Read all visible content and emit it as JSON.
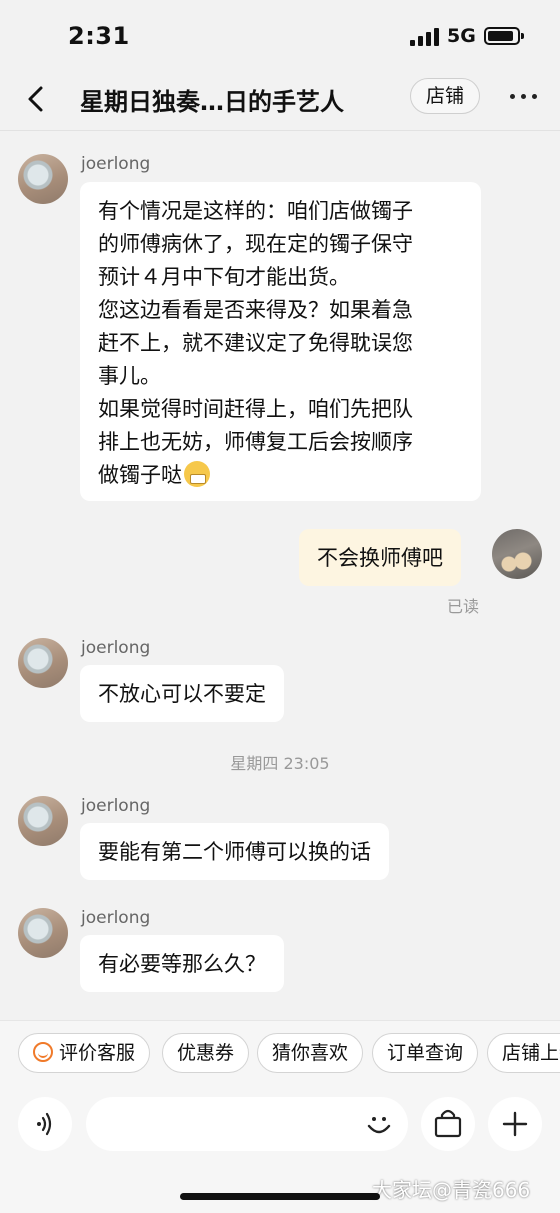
{
  "status_bar": {
    "time": "2:31",
    "network": "5G"
  },
  "nav": {
    "title": "星期日独奏…日的手艺人",
    "shop_button": "店铺"
  },
  "messages": [
    {
      "sender": "joerlong",
      "lines": [
        "有个情况是这样的：咱们店做镯子",
        "的师傅病休了，现在定的镯子保守",
        "预计４月中下旬才能出货。",
        "您这边看看是否来得及？如果着急",
        "赶不上，就不建议定了免得耽误您",
        "事儿。",
        "如果觉得时间赶得上，咱们先把队",
        "排上也无妨，师傅复工后会按顺序",
        "做镯子哒"
      ]
    },
    {
      "text": "不会换师傅吧",
      "status": "已读"
    },
    {
      "sender": "joerlong",
      "text": "不放心可以不要定"
    },
    {
      "timestamp": "星期四 23:05"
    },
    {
      "sender": "joerlong",
      "text": "要能有第二个师傅可以换的话"
    },
    {
      "sender": "joerlong",
      "text": "有必要等那么久？"
    }
  ],
  "quick_actions": [
    "评价客服",
    "优惠券",
    "猜你喜欢",
    "订单查询",
    "店铺上新"
  ],
  "input": {
    "placeholder": ""
  },
  "watermark": "大家坛@青瓷666",
  "icons": {
    "back": "back-arrow-icon",
    "more": "more-dots-icon",
    "voice": "voice-icon",
    "emoji": "emoji-icon",
    "shop_bag": "shopping-bag-icon",
    "plus": "plus-icon"
  }
}
